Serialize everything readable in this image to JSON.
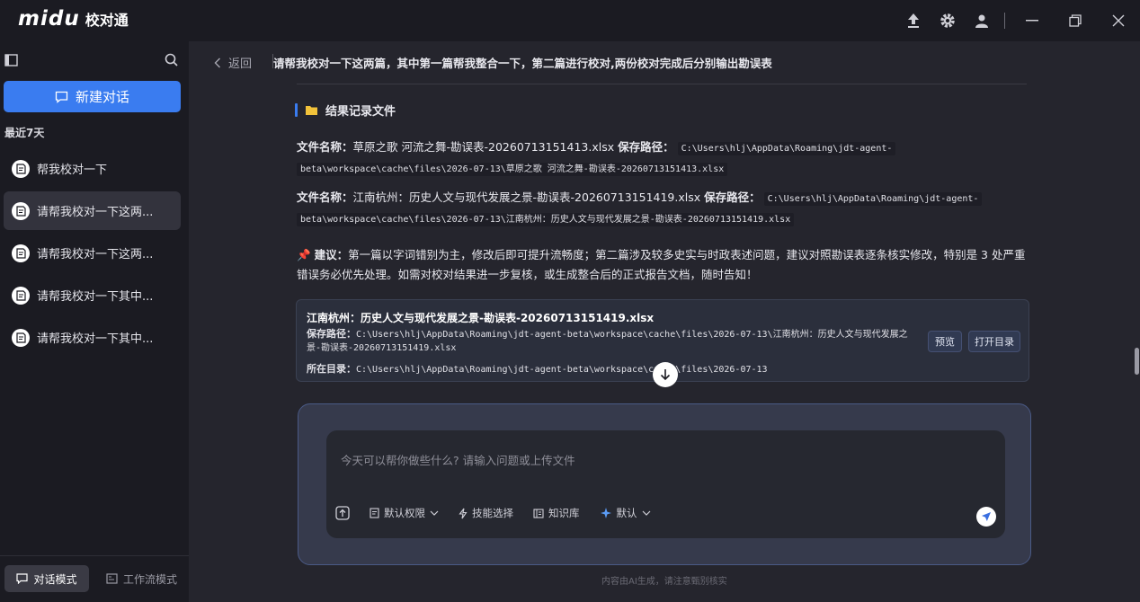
{
  "app": {
    "logo_mark": "midu",
    "logo_name": "校对通"
  },
  "sidebar": {
    "new_chat_label": "新建对话",
    "recent_label": "最近7天",
    "items": [
      {
        "label": "帮我校对一下",
        "active": false
      },
      {
        "label": "请帮我校对一下这两...",
        "active": true
      },
      {
        "label": "请帮我校对一下这两...",
        "active": false
      },
      {
        "label": "请帮我校对一下其中...",
        "active": false
      },
      {
        "label": "请帮我校对一下其中...",
        "active": false
      }
    ],
    "modes": {
      "chat": "对话模式",
      "workflow": "工作流模式"
    }
  },
  "header": {
    "back_label": "返回",
    "title": "请帮我校对一下这两篇，其中第一篇帮我整合一下，第二篇进行校对,两份校对完成后分别输出勘误表"
  },
  "content": {
    "section_title": "结果记录文件",
    "file_name_label": "文件名称：",
    "save_path_label": "保存路径：",
    "files": [
      {
        "name": "草原之歌 河流之舞-勘误表-20260713151413.xlsx",
        "path_a": "C:\\Users\\hlj\\AppData\\Roaming\\jdt-agent-",
        "path_b": "beta\\workspace\\cache\\files\\2026-07-13\\草原之歌 河流之舞-勘误表-20260713151413.xlsx"
      },
      {
        "name": "江南杭州：历史人文与现代发展之景-勘误表-20260713151419.xlsx",
        "path_a": "C:\\Users\\hlj\\AppData\\Roaming\\jdt-agent-",
        "path_b": "beta\\workspace\\cache\\files\\2026-07-13\\江南杭州：历史人文与现代发展之景-勘误表-20260713151419.xlsx"
      }
    ],
    "suggest_label": "建议：",
    "suggest_text": "第一篇以字词错别为主，修改后即可提升流畅度；第二篇涉及较多史实与时政表述问题，建议对照勘误表逐条核实修改，特别是 3 处严重错误务必优先处理。如需对校对结果进一步复核，或生成整合后的正式报告文档，随时告知！"
  },
  "file_card": {
    "name": "江南杭州：历史人文与现代发展之景-勘误表-20260713151419.xlsx",
    "path_label": "保存路径：",
    "path_value": "C:\\Users\\hlj\\AppData\\Roaming\\jdt-agent-beta\\workspace\\cache\\files\\2026-07-13\\江南杭州：历史人文与现代发展之景-勘误表-20260713151419.xlsx",
    "dir_label": "所在目录：",
    "dir_value": "C:\\Users\\hlj\\AppData\\Roaming\\jdt-agent-beta\\workspace\\cache\\files\\2026-07-13",
    "preview_label": "预览",
    "open_dir_label": "打开目录"
  },
  "composer": {
    "placeholder": "今天可以帮你做些什么? 请输入问题或上传文件",
    "permission_label": "默认权限",
    "skill_label": "技能选择",
    "kb_label": "知识库",
    "model_label": "默认"
  },
  "footer": {
    "disclaimer": "内容由AI生成，请注意甄别核实"
  },
  "colors": {
    "accent": "#3a7cf0",
    "sidebar_bg": "#1b1b22",
    "main_bg": "#25252d"
  }
}
